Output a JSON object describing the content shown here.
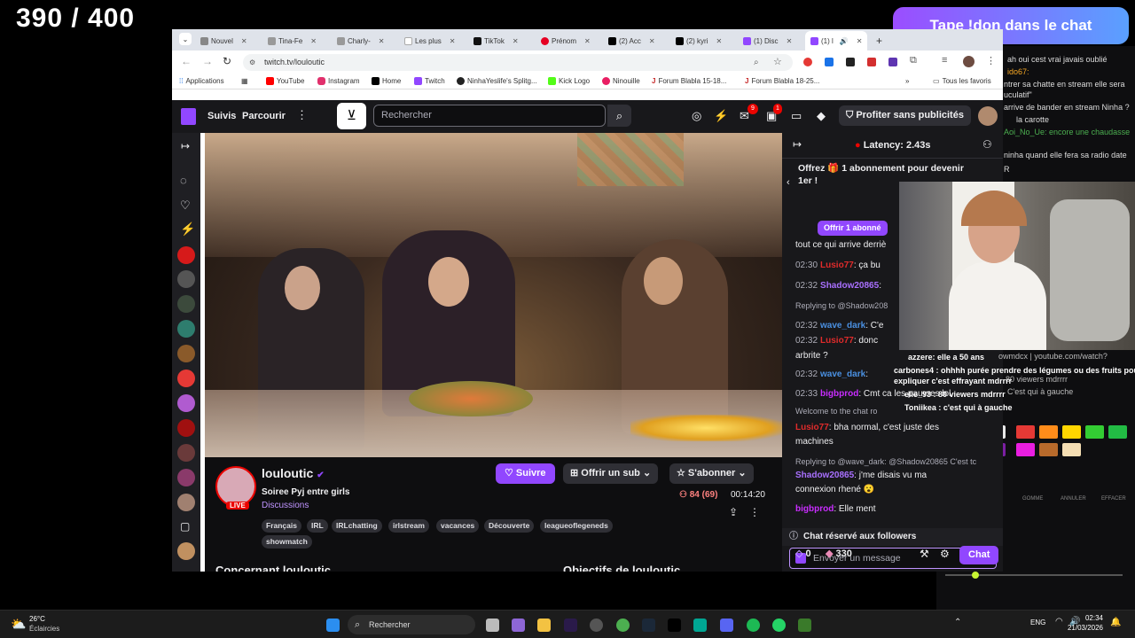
{
  "overlay": {
    "counter": "390 / 400",
    "donate_banner": "Tape !don dans le chat",
    "side_chat": [
      "ah oui cest vrai javais oublié",
      "ido67:",
      "ntrer sa chatte en stream elle sera",
      "uculatif\"",
      "arrive de bander en stream Ninha ?",
      "la carotte",
      "Aoi_No_Ue: encore une chaudasse",
      "ninha quand elle fera sa radio date",
      "R"
    ],
    "cam_chat": [
      "azzere: elle a 50 ans",
      "carbones4 : ohhhh purée prendre des légumes ou des fruits pour",
      "expliquer c'est effrayant mdrrrr",
      "elie_93 : 80 viewers mdrrrr",
      "Toniikea : c'est qui à gauche"
    ],
    "cam_chat_behind": [
      "owmdcx | youtube.com/watch?",
      "80 viewers mdrrrr",
      "C'est qui à gauche"
    ],
    "draw_tools": [
      "GOMME",
      "ANNULER",
      "EFFACER"
    ],
    "palette_colors": [
      "#e8e8e8",
      "#e53935",
      "#ff8c1a",
      "#ffd600",
      "#33cc33",
      "#22bb44",
      "#7b1fa2",
      "#e91ee0",
      "#b86a2b",
      "#f5deb3"
    ]
  },
  "browser": {
    "tabs": [
      "Nouvel",
      "Tina-Fe",
      "Charly-",
      "Les plus",
      "TikTok",
      "Prénom",
      "(2) Acc",
      "(2) kyri",
      "(1) Disc",
      "(1) l"
    ],
    "url": "twitch.tv/louloutic",
    "bookmarks": [
      "Applications",
      "YouTube",
      "Instagram",
      "Home",
      "Twitch",
      "NinhaYeslife's Splitg...",
      "Kick Logo",
      "Ninouille",
      "Forum Blabla 15-18...",
      "Forum Blabla 18-25...",
      "Tous les favoris"
    ]
  },
  "twitch": {
    "nav": {
      "following": "Suivis",
      "browse": "Parcourir",
      "search_placeholder": "Rechercher",
      "notif_count": "9",
      "inbox_count": "1",
      "turbo": "Profiter sans publicités"
    },
    "channel": {
      "name": "louloutic",
      "title": "Soiree Pyj entre girls",
      "category": "Discussions",
      "live": "LIVE",
      "follow": "Suivre",
      "gift": "Offrir un sub",
      "subscribe": "S'abonner",
      "viewers": "84 (69)",
      "uptime": "00:14:20",
      "tags": [
        "Français",
        "IRL",
        "IRLchatting",
        "irlstream",
        "vacances",
        "Découverte",
        "leagueoflegeneds",
        "showmatch"
      ],
      "about": "Concernant louloutic",
      "goals": "Objectifs de louloutic"
    },
    "chat": {
      "latency": "Latency: 2.43s",
      "gift_banner": "Offrez 🎁 1 abonnement pour devenir 1er !",
      "gift_button": "Offrir 1 abonné",
      "pinned_text": "tout ce qui arrive derriè",
      "messages": [
        {
          "time": "02:30",
          "user": "Lusio77",
          "color": "#e02b2b",
          "text": "ça bu"
        },
        {
          "time": "02:32",
          "user": "Shadow20865",
          "color": "#a970ff",
          "text": ""
        },
        {
          "time": "",
          "user": "",
          "color": "#adadb8",
          "text": "Replying to @Shadow208"
        },
        {
          "time": "02:32",
          "user": "wave_dark",
          "color": "#4a90e2",
          "text": "C'e"
        },
        {
          "time": "02:32",
          "user": "Lusio77",
          "color": "#e02b2b",
          "text": "donc"
        },
        {
          "time": "",
          "user": "",
          "color": "#efeff1",
          "text": "arbrite ?"
        },
        {
          "time": "02:32",
          "user": "wave_dark",
          "color": "#4a90e2",
          "text": ""
        },
        {
          "time": "02:33",
          "user": "bigbprod",
          "color": "#c92dff",
          "text": "Cmt ca les pauvres lol"
        },
        {
          "time": "",
          "user": "",
          "color": "#adadb8",
          "text": "Welcome to the chat ro"
        },
        {
          "time": "",
          "user": "Lusio77",
          "color": "#e02b2b",
          "text": "bha normal, c'est juste des"
        },
        {
          "time": "",
          "user": "",
          "color": "#efeff1",
          "text": "machines"
        },
        {
          "time": "",
          "user": "",
          "color": "#adadb8",
          "text": "Replying to @wave_dark: @Shadow20865 C'est tc"
        },
        {
          "time": "",
          "user": "Shadow20865",
          "color": "#a970ff",
          "text": "j'me disais vu ma"
        },
        {
          "time": "",
          "user": "",
          "color": "#efeff1",
          "text": "connexion rhené 😮"
        },
        {
          "time": "",
          "user": "bigbprod",
          "color": "#c92dff",
          "text": "Elle ment"
        }
      ],
      "followers_only": "Chat réservé aux followers",
      "input_placeholder": "Envoyer un message",
      "points": "0",
      "bits": "330",
      "send": "Chat"
    }
  },
  "taskbar": {
    "temp": "26°C",
    "weather": "Éclaircies",
    "search": "Rechercher",
    "lang": "ENG",
    "time": "02:34",
    "date": "21/03/2026"
  },
  "colors": {
    "twitch_purple": "#9147ff",
    "live_red": "#eb0400"
  }
}
